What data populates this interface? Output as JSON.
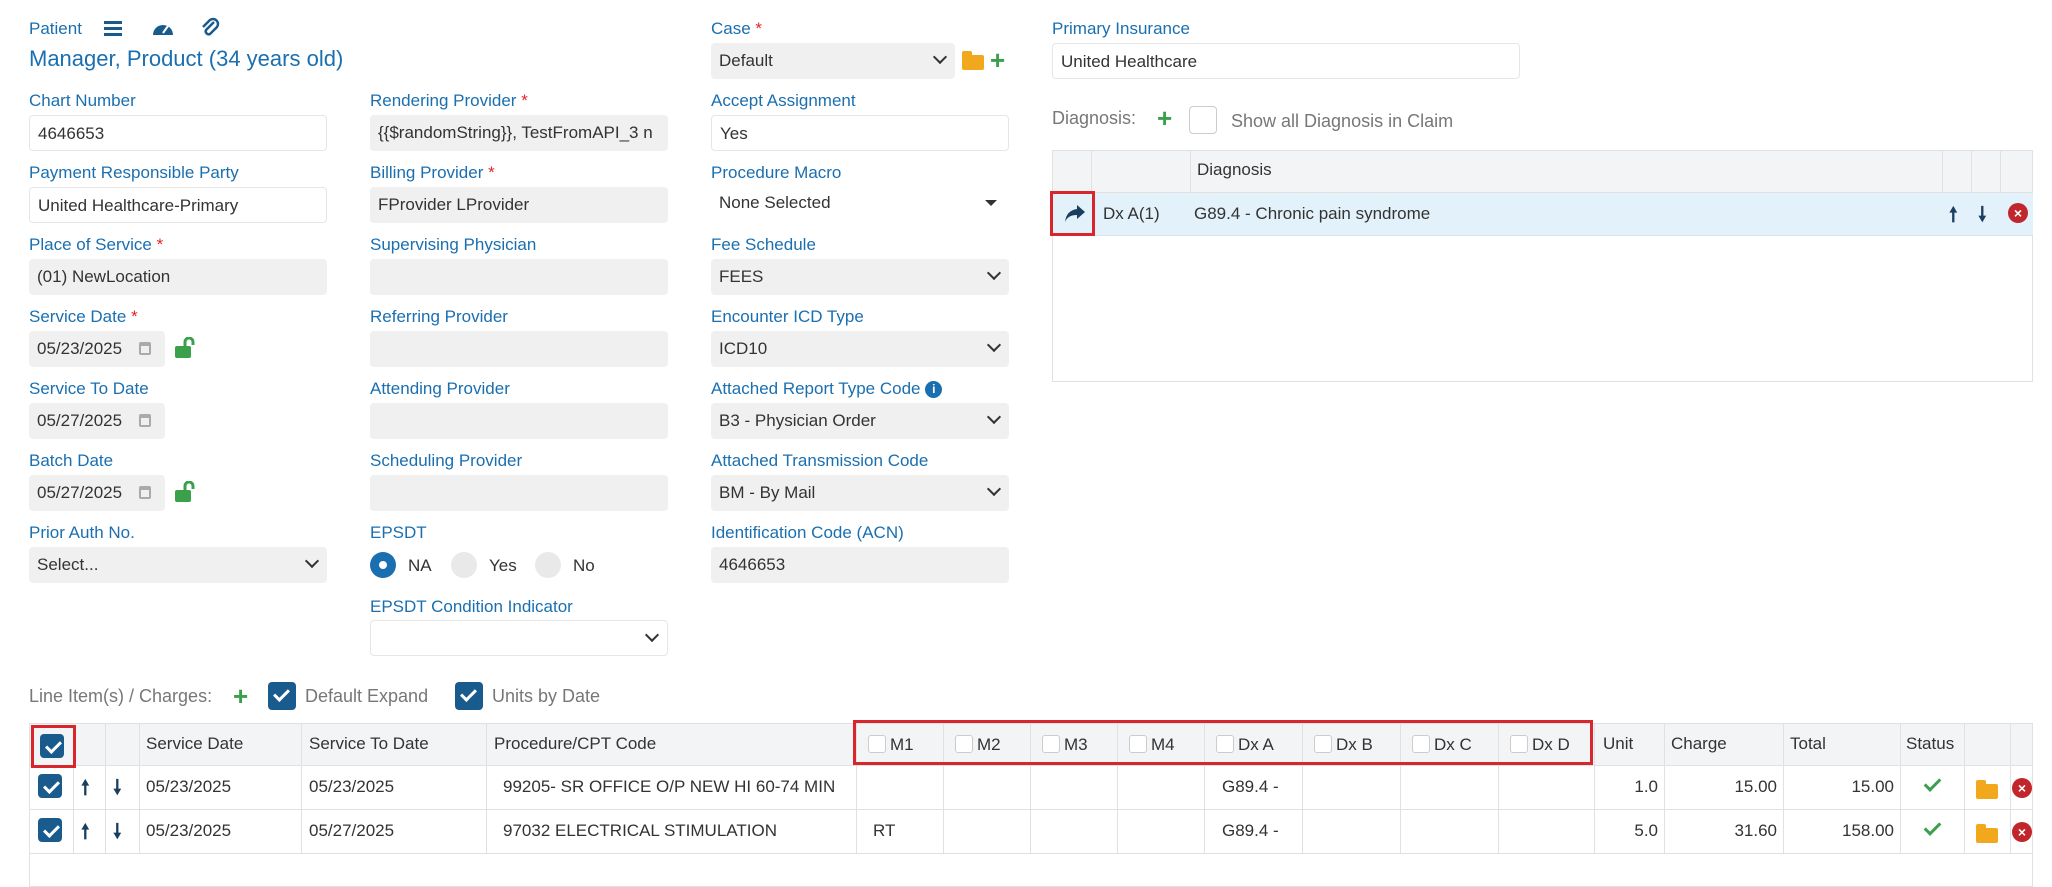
{
  "patient": {
    "label": "Patient",
    "name": "Manager, Product (34 years old)"
  },
  "fields": {
    "chart_number": {
      "label": "Chart Number",
      "value": "4646653"
    },
    "payment_party": {
      "label": "Payment Responsible Party",
      "value": "United Healthcare-Primary"
    },
    "place_of_service": {
      "label": "Place of Service",
      "value": "(01) NewLocation"
    },
    "service_date": {
      "label": "Service Date",
      "value": "05/23/2025"
    },
    "service_to_date": {
      "label": "Service To Date",
      "value": "05/27/2025"
    },
    "batch_date": {
      "label": "Batch Date",
      "value": "05/27/2025"
    },
    "prior_auth": {
      "label": "Prior Auth No.",
      "value": "Select..."
    },
    "rendering_provider": {
      "label": "Rendering Provider",
      "value": "{{$randomString}}, TestFromAPI_3 n"
    },
    "billing_provider": {
      "label": "Billing Provider",
      "value": "FProvider LProvider"
    },
    "supervising_physician": {
      "label": "Supervising Physician",
      "value": ""
    },
    "referring_provider": {
      "label": "Referring Provider",
      "value": ""
    },
    "attending_provider": {
      "label": "Attending Provider",
      "value": ""
    },
    "scheduling_provider": {
      "label": "Scheduling Provider",
      "value": ""
    },
    "epsdt": {
      "label": "EPSDT",
      "options": [
        "NA",
        "Yes",
        "No"
      ],
      "selected": "NA"
    },
    "epsdt_condition": {
      "label": "EPSDT Condition Indicator",
      "value": ""
    },
    "case": {
      "label": "Case",
      "value": "Default"
    },
    "accept_assignment": {
      "label": "Accept Assignment",
      "value": "Yes"
    },
    "procedure_macro": {
      "label": "Procedure Macro",
      "value": "None Selected"
    },
    "fee_schedule": {
      "label": "Fee Schedule",
      "value": "FEES"
    },
    "encounter_icd": {
      "label": "Encounter ICD Type",
      "value": "ICD10"
    },
    "report_type_code": {
      "label": "Attached Report Type Code",
      "value": "B3 - Physician Order"
    },
    "transmission_code": {
      "label": "Attached Transmission Code",
      "value": "BM - By Mail"
    },
    "identification_code": {
      "label": "Identification Code (ACN)",
      "value": "4646653"
    },
    "primary_insurance": {
      "label": "Primary Insurance",
      "value": "United Healthcare"
    }
  },
  "diagnosis": {
    "label": "Diagnosis:",
    "show_all_label": "Show all Diagnosis in Claim",
    "column_header": "Diagnosis",
    "rows": [
      {
        "code": "Dx A(1)",
        "description": "G89.4 - Chronic pain syndrome"
      }
    ]
  },
  "line_items": {
    "label": "Line Item(s) / Charges:",
    "default_expand_label": "Default Expand",
    "units_by_date_label": "Units by Date",
    "headers": {
      "service_date": "Service Date",
      "service_to_date": "Service To Date",
      "procedure": "Procedure/CPT Code",
      "m1": "M1",
      "m2": "M2",
      "m3": "M3",
      "m4": "M4",
      "dxa": "Dx A",
      "dxb": "Dx B",
      "dxc": "Dx C",
      "dxd": "Dx D",
      "unit": "Unit",
      "charge": "Charge",
      "total": "Total",
      "status": "Status"
    },
    "rows": [
      {
        "service_date": "05/23/2025",
        "service_to_date": "05/23/2025",
        "procedure": "99205- SR OFFICE O/P NEW HI 60-74 MIN",
        "m1": "",
        "dxa": "G89.4 -",
        "unit": "1.0",
        "charge": "15.00",
        "total": "15.00"
      },
      {
        "service_date": "05/23/2025",
        "service_to_date": "05/27/2025",
        "procedure": "97032 ELECTRICAL STIMULATION",
        "m1": "RT",
        "dxa": "G89.4 -",
        "unit": "5.0",
        "charge": "31.60",
        "total": "158.00"
      }
    ]
  },
  "colors": {
    "label_blue": "#1a6fb0",
    "required_red": "#e0262b",
    "add_green": "#3aa04b",
    "checkbox_navy": "#1a5b8d",
    "highlight_row": "#e3f1fb",
    "annotation_red": "#d9262c"
  }
}
